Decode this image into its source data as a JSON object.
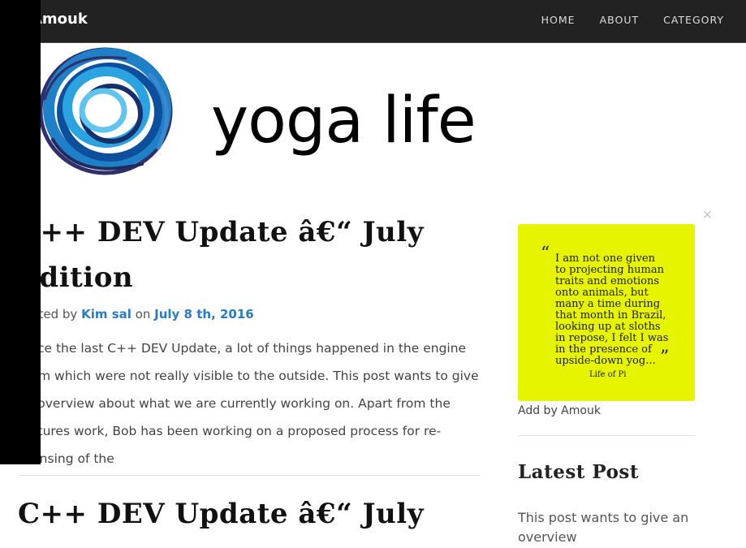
{
  "navbar": {
    "brand": "Amouk",
    "links": [
      "HOME",
      "ABOUT",
      "CATEGORY"
    ]
  },
  "logo": {
    "text": "yoga life"
  },
  "post": {
    "title": "C++ DEV Update â€“ July Edition",
    "meta": {
      "prefix": "Posted by",
      "author": "Kim sal",
      "on": "on",
      "date": "July 8 th, 2016"
    },
    "excerpt": "Since the last C++ DEV Update, a lot of things happened in the engine room which were not really visible to the outside. This post wants to give an overview about what we are currently working on. Apart from the features work, Bob has been working on a proposed process for re-licensing of the"
  },
  "second_post": {
    "title": "C++ DEV Update â€“ July"
  },
  "sidebar": {
    "ad": {
      "close": "×",
      "quote_open": "“",
      "quote_close": "”",
      "quote_text": "I am not one given to projecting human traits and emotions onto animals, but many a time during that month in Brazil, looking up at sloths in repose, I felt I was in the presence of upside-down yog...",
      "quote_author": "Life of Pi",
      "caption": "Add by Amouk",
      "background": "#e7f400"
    },
    "latest": {
      "title": "Latest Post",
      "item": "This post wants to give an overview"
    }
  },
  "colors": {
    "navbar": "#222222",
    "link": "#2a7ac7"
  }
}
